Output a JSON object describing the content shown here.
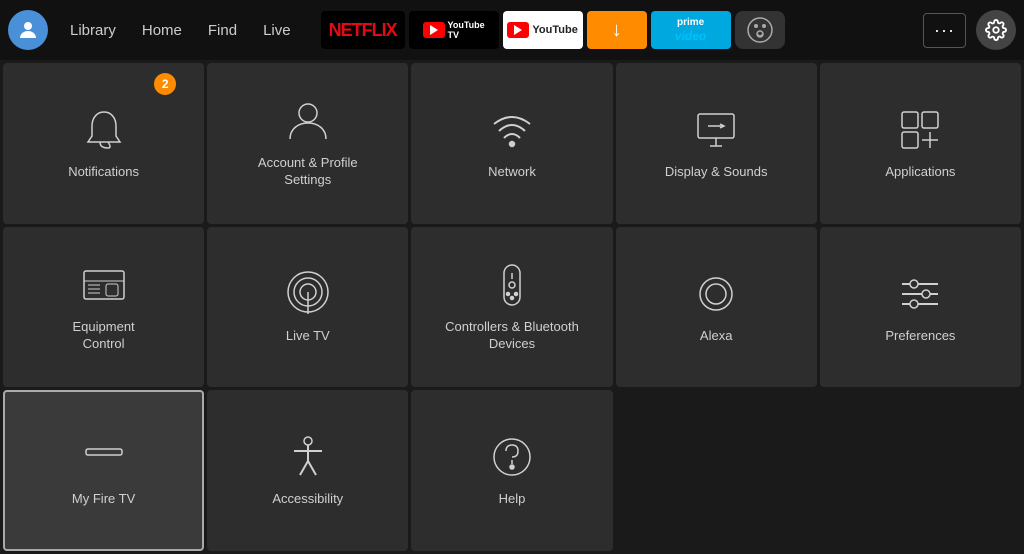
{
  "nav": {
    "links": [
      "Library",
      "Home",
      "Find",
      "Live"
    ],
    "more_label": "···",
    "notification_badge": "2"
  },
  "grid": {
    "items": [
      {
        "id": "notifications",
        "label": "Notifications",
        "icon": "bell",
        "badge": "2",
        "selected": false
      },
      {
        "id": "account-profile",
        "label": "Account & Profile\nSettings",
        "icon": "person",
        "selected": false
      },
      {
        "id": "network",
        "label": "Network",
        "icon": "wifi",
        "selected": false
      },
      {
        "id": "display-sounds",
        "label": "Display & Sounds",
        "icon": "display",
        "selected": false
      },
      {
        "id": "applications",
        "label": "Applications",
        "icon": "apps",
        "selected": false
      },
      {
        "id": "equipment-control",
        "label": "Equipment\nControl",
        "icon": "tv",
        "selected": false
      },
      {
        "id": "live-tv",
        "label": "Live TV",
        "icon": "antenna",
        "selected": false
      },
      {
        "id": "controllers-bluetooth",
        "label": "Controllers & Bluetooth\nDevices",
        "icon": "remote",
        "selected": false
      },
      {
        "id": "alexa",
        "label": "Alexa",
        "icon": "alexa",
        "selected": false
      },
      {
        "id": "preferences",
        "label": "Preferences",
        "icon": "sliders",
        "selected": false
      },
      {
        "id": "my-fire-tv",
        "label": "My Fire TV",
        "icon": "firetv",
        "selected": true
      },
      {
        "id": "accessibility",
        "label": "Accessibility",
        "icon": "accessibility",
        "selected": false
      },
      {
        "id": "help",
        "label": "Help",
        "icon": "help",
        "selected": false
      },
      {
        "id": "empty1",
        "label": "",
        "icon": "none",
        "selected": false
      },
      {
        "id": "empty2",
        "label": "",
        "icon": "none",
        "selected": false
      }
    ]
  }
}
